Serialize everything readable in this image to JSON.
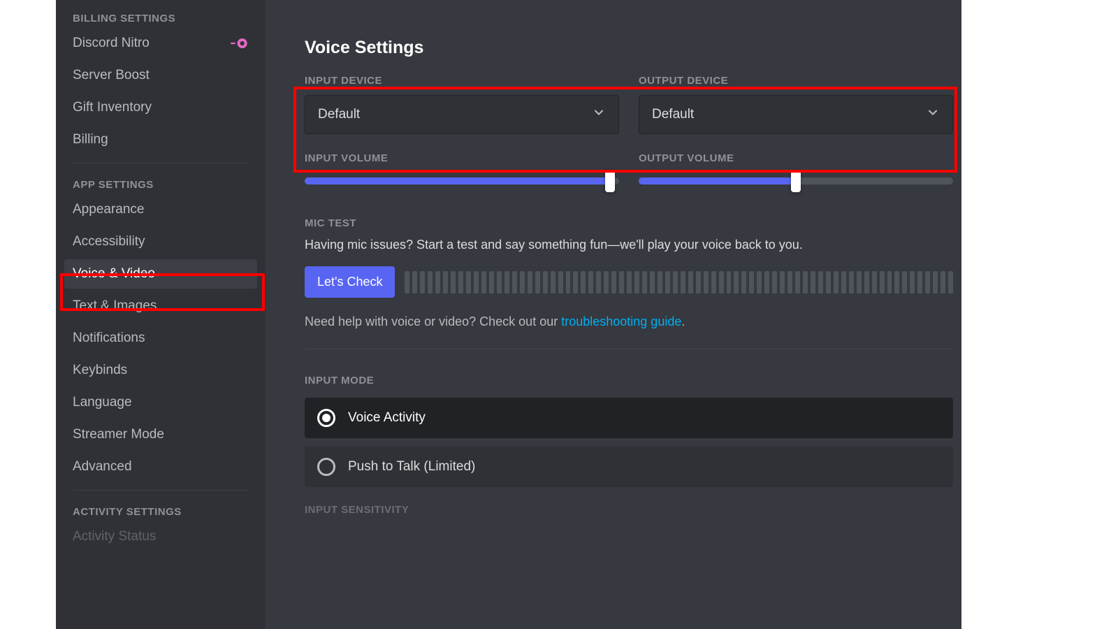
{
  "sidebar": {
    "sections": {
      "billing": {
        "header": "BILLING SETTINGS",
        "items": [
          {
            "label": "Discord Nitro",
            "has_nitro_icon": true
          },
          {
            "label": "Server Boost"
          },
          {
            "label": "Gift Inventory"
          },
          {
            "label": "Billing"
          }
        ]
      },
      "app": {
        "header": "APP SETTINGS",
        "items": [
          {
            "label": "Appearance"
          },
          {
            "label": "Accessibility"
          },
          {
            "label": "Voice & Video",
            "active": true
          },
          {
            "label": "Text & Images"
          },
          {
            "label": "Notifications"
          },
          {
            "label": "Keybinds"
          },
          {
            "label": "Language"
          },
          {
            "label": "Streamer Mode"
          },
          {
            "label": "Advanced"
          }
        ]
      },
      "activity": {
        "header": "ACTIVITY SETTINGS",
        "items_cut": "Activity Status"
      }
    }
  },
  "main": {
    "title": "Voice Settings",
    "input_device": {
      "label": "INPUT DEVICE",
      "value": "Default"
    },
    "output_device": {
      "label": "OUTPUT DEVICE",
      "value": "Default"
    },
    "input_volume": {
      "label": "INPUT VOLUME",
      "percent": 97
    },
    "output_volume": {
      "label": "OUTPUT VOLUME",
      "percent": 50
    },
    "mic_test": {
      "label": "MIC TEST",
      "desc": "Having mic issues? Start a test and say something fun—we'll play your voice back to you.",
      "button": "Let's Check",
      "meter_bars": 72
    },
    "help": {
      "prefix": "Need help with voice or video? Check out our ",
      "link": "troubleshooting guide",
      "suffix": "."
    },
    "input_mode": {
      "label": "INPUT MODE",
      "options": [
        {
          "label": "Voice Activity",
          "selected": true
        },
        {
          "label": "Push to Talk (Limited)",
          "selected": false
        }
      ]
    },
    "cutoff_label": "INPUT SENSITIVITY"
  },
  "colors": {
    "accent": "#5865f2",
    "link": "#00aff4",
    "nitro": "#e668c6",
    "highlight": "#ff0000"
  }
}
